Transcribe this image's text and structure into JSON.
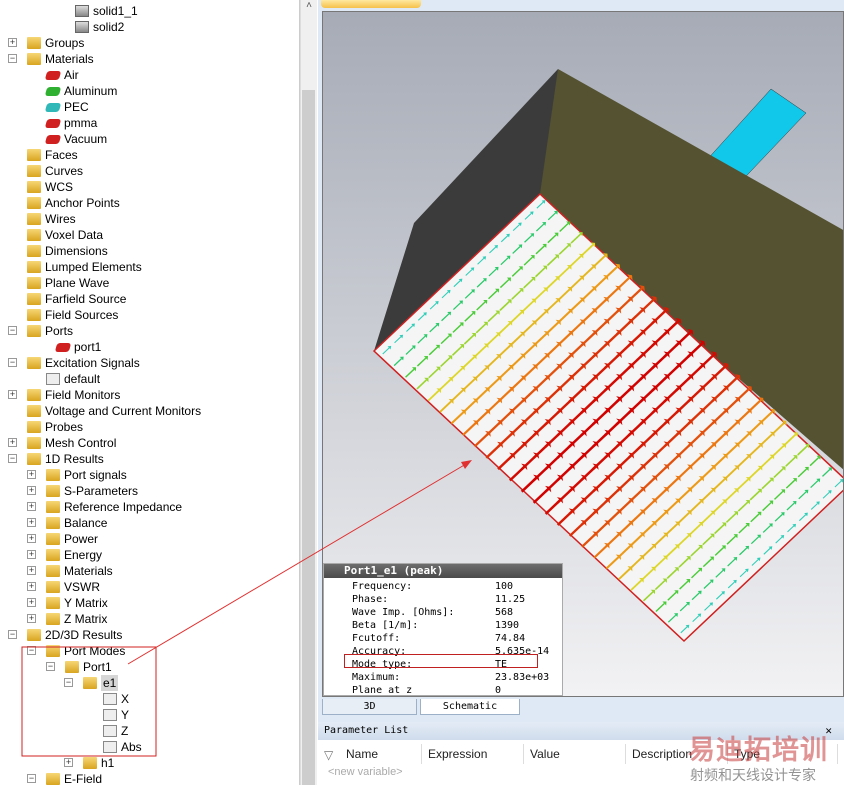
{
  "tree": [
    {
      "label": "solid1_1",
      "indent": 93,
      "icon": "solid-icon"
    },
    {
      "label": "solid2",
      "indent": 93,
      "icon": "solid-icon"
    },
    {
      "label": "Groups",
      "indent": 45,
      "icon": "folder-icon",
      "exp": "+"
    },
    {
      "label": "Materials",
      "indent": 45,
      "icon": "folder-icon",
      "exp": "-"
    },
    {
      "label": "Air",
      "indent": 64,
      "icon": "material-icon",
      "color": "#d02020"
    },
    {
      "label": "Aluminum",
      "indent": 64,
      "icon": "material-icon",
      "color": "#30b030"
    },
    {
      "label": "PEC",
      "indent": 64,
      "icon": "material-icon",
      "color": "#30b8b8"
    },
    {
      "label": "pmma",
      "indent": 64,
      "icon": "material-icon",
      "color": "#d02020"
    },
    {
      "label": "Vacuum",
      "indent": 64,
      "icon": "material-icon",
      "color": "#d02020"
    },
    {
      "label": "Faces",
      "indent": 45,
      "icon": "folder-icon"
    },
    {
      "label": "Curves",
      "indent": 45,
      "icon": "folder-icon"
    },
    {
      "label": "WCS",
      "indent": 45,
      "icon": "folder-icon"
    },
    {
      "label": "Anchor Points",
      "indent": 45,
      "icon": "folder-icon"
    },
    {
      "label": "Wires",
      "indent": 45,
      "icon": "folder-icon"
    },
    {
      "label": "Voxel Data",
      "indent": 45,
      "icon": "folder-icon"
    },
    {
      "label": "Dimensions",
      "indent": 45,
      "icon": "folder-icon"
    },
    {
      "label": "Lumped Elements",
      "indent": 45,
      "icon": "folder-icon"
    },
    {
      "label": "Plane Wave",
      "indent": 45,
      "icon": "folder-icon"
    },
    {
      "label": "Farfield Source",
      "indent": 45,
      "icon": "folder-icon"
    },
    {
      "label": "Field Sources",
      "indent": 45,
      "icon": "folder-icon"
    },
    {
      "label": "Ports",
      "indent": 45,
      "icon": "folder-icon",
      "exp": "-"
    },
    {
      "label": "port1",
      "indent": 74,
      "icon": "port-icon",
      "color": "#d02020"
    },
    {
      "label": "Excitation Signals",
      "indent": 45,
      "icon": "folder-icon",
      "exp": "-"
    },
    {
      "label": "default",
      "indent": 64,
      "icon": "signal-icon"
    },
    {
      "label": "Field Monitors",
      "indent": 45,
      "icon": "folder-icon",
      "exp": "+"
    },
    {
      "label": "Voltage and Current Monitors",
      "indent": 45,
      "icon": "folder-icon"
    },
    {
      "label": "Probes",
      "indent": 45,
      "icon": "folder-icon"
    },
    {
      "label": "Mesh Control",
      "indent": 45,
      "icon": "folder-icon",
      "exp": "+"
    },
    {
      "label": "1D Results",
      "indent": 45,
      "icon": "results-icon",
      "exp": "-"
    },
    {
      "label": "Port signals",
      "indent": 64,
      "icon": "folder-icon",
      "exp": "+"
    },
    {
      "label": "S-Parameters",
      "indent": 64,
      "icon": "folder-icon",
      "exp": "+"
    },
    {
      "label": "Reference Impedance",
      "indent": 64,
      "icon": "folder-icon",
      "exp": "+"
    },
    {
      "label": "Balance",
      "indent": 64,
      "icon": "folder-icon",
      "exp": "+"
    },
    {
      "label": "Power",
      "indent": 64,
      "icon": "folder-icon",
      "exp": "+"
    },
    {
      "label": "Energy",
      "indent": 64,
      "icon": "folder-icon",
      "exp": "+"
    },
    {
      "label": "Materials",
      "indent": 64,
      "icon": "folder-icon",
      "exp": "+"
    },
    {
      "label": "VSWR",
      "indent": 64,
      "icon": "folder-icon",
      "exp": "+"
    },
    {
      "label": "Y Matrix",
      "indent": 64,
      "icon": "folder-icon",
      "exp": "+"
    },
    {
      "label": "Z Matrix",
      "indent": 64,
      "icon": "folder-icon",
      "exp": "+"
    },
    {
      "label": "2D/3D Results",
      "indent": 45,
      "icon": "results-icon",
      "exp": "-"
    },
    {
      "label": "Port Modes",
      "indent": 64,
      "icon": "folder-icon",
      "exp": "-"
    },
    {
      "label": "Port1",
      "indent": 83,
      "icon": "folder-icon",
      "exp": "-"
    },
    {
      "label": "e1",
      "indent": 101,
      "icon": "folder-icon",
      "exp": "-",
      "selected": true
    },
    {
      "label": "X",
      "indent": 121,
      "icon": "signal-icon"
    },
    {
      "label": "Y",
      "indent": 121,
      "icon": "signal-icon"
    },
    {
      "label": "Z",
      "indent": 121,
      "icon": "signal-icon"
    },
    {
      "label": "Abs",
      "indent": 121,
      "icon": "signal-icon"
    },
    {
      "label": "h1",
      "indent": 101,
      "icon": "folder-icon",
      "exp": "+"
    },
    {
      "label": "E-Field",
      "indent": 64,
      "icon": "folder-icon",
      "exp": "-"
    }
  ],
  "info": {
    "title": "Port1_e1 (peak)",
    "rows": [
      {
        "k": "Frequency:",
        "v": "100"
      },
      {
        "k": "Phase:",
        "v": "11.25"
      },
      {
        "k": "Wave Imp. [Ohms]:",
        "v": "568"
      },
      {
        "k": "Beta [1/m]:",
        "v": "1390"
      },
      {
        "k": "Fcutoff:",
        "v": "74.84"
      },
      {
        "k": "Accuracy:",
        "v": "5.635e-14"
      },
      {
        "k": "Mode type:",
        "v": "TE"
      },
      {
        "k": "Maximum:",
        "v": "23.83e+03"
      },
      {
        "k": "Plane at z",
        "v": "0"
      }
    ]
  },
  "tabs": {
    "t3d": "3D",
    "schematic": "Schematic"
  },
  "param": {
    "title": "Parameter List",
    "close": "✕",
    "cols": [
      "Name",
      "Expression",
      "Value",
      "Description",
      "Type"
    ],
    "new_var": "<new variable>"
  },
  "watermark": {
    "line1": "易迪拓培训",
    "line2": "射频和天线设计专家"
  },
  "colors": {
    "highlight": "#d02020",
    "field_high": "#d00000",
    "field_low": "#30d0e0"
  }
}
